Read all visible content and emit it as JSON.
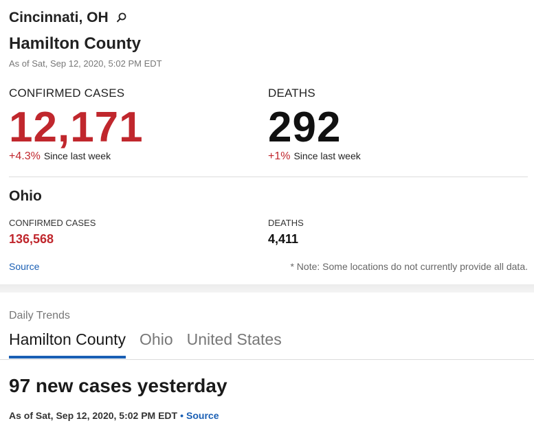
{
  "header": {
    "location": "Cincinnati, OH",
    "county": "Hamilton County",
    "as_of": "As of Sat, Sep 12, 2020, 5:02 PM EDT"
  },
  "county_stats": {
    "confirmed_label": "CONFIRMED CASES",
    "confirmed_value": "12,171",
    "confirmed_change": "+4.3%",
    "confirmed_change_suffix": "Since last week",
    "deaths_label": "DEATHS",
    "deaths_value": "292",
    "deaths_change": "+1%",
    "deaths_change_suffix": "Since last week"
  },
  "state_stats": {
    "name": "Ohio",
    "confirmed_label": "CONFIRMED CASES",
    "confirmed_value": "136,568",
    "deaths_label": "DEATHS",
    "deaths_value": "4,411",
    "source_label": "Source",
    "note": "* Note: Some locations do not currently provide all data."
  },
  "trends": {
    "section_label": "Daily Trends",
    "tabs": [
      {
        "label": "Hamilton County",
        "active": true
      },
      {
        "label": "Ohio",
        "active": false
      },
      {
        "label": "United States",
        "active": false
      }
    ],
    "headline": "97 new cases yesterday",
    "as_of": "As of Sat, Sep 12, 2020, 5:02 PM EDT",
    "separator": "•",
    "source_label": "Source"
  },
  "colors": {
    "accent": "#1a5fb4",
    "cases_red": "#c0272d"
  },
  "icons": [
    "search-icon"
  ]
}
